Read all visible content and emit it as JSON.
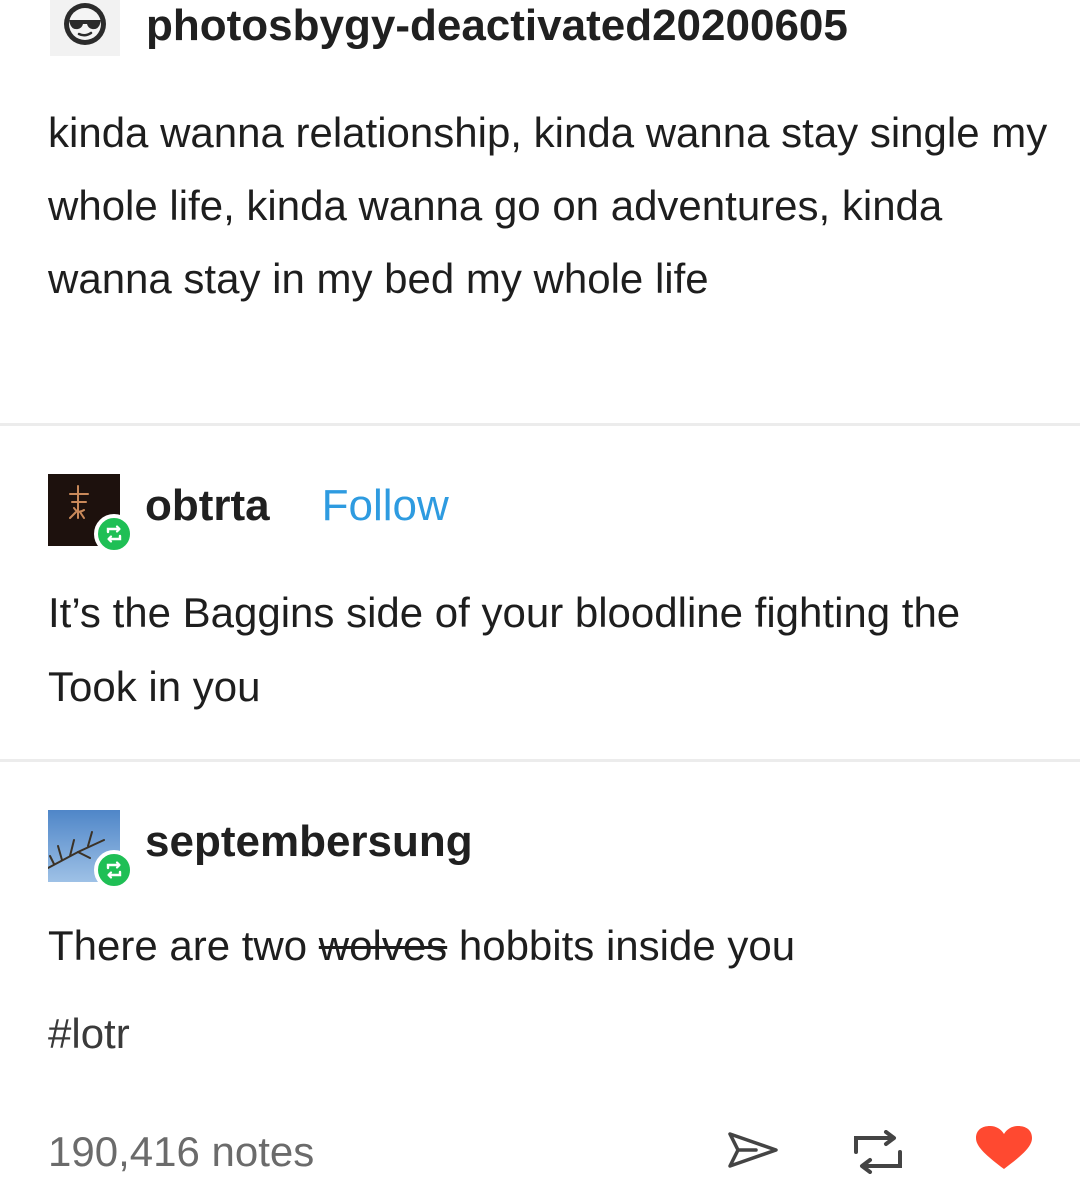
{
  "posts": [
    {
      "username": "photosbygy-deactivated20200605",
      "text": "kinda wanna relationship, kinda wanna stay single my whole life, kinda wanna go on adventures, kinda wanna stay in my bed my whole life",
      "avatar_icon": "sunglasses-face-icon"
    },
    {
      "username": "obtrta",
      "follow_label": "Follow",
      "text": "It’s the Baggins side of your bloodline fighting the Took in you",
      "avatar_icon": "avatar-image",
      "badge_icon": "reblog-icon"
    },
    {
      "username": "septembersung",
      "text_before": "There are two ",
      "text_struck": "wolves",
      "text_after": " hobbits inside you",
      "tag": "#lotr",
      "avatar_icon": "avatar-image",
      "badge_icon": "reblog-icon"
    }
  ],
  "footer": {
    "notes": "190,416 notes",
    "actions": [
      "share-icon",
      "reblog-icon",
      "like-heart-icon"
    ]
  },
  "colors": {
    "follow": "#2e9be0",
    "reblog_badge": "#1fbf55",
    "heart": "#ff4930",
    "divider": "#ececec"
  }
}
